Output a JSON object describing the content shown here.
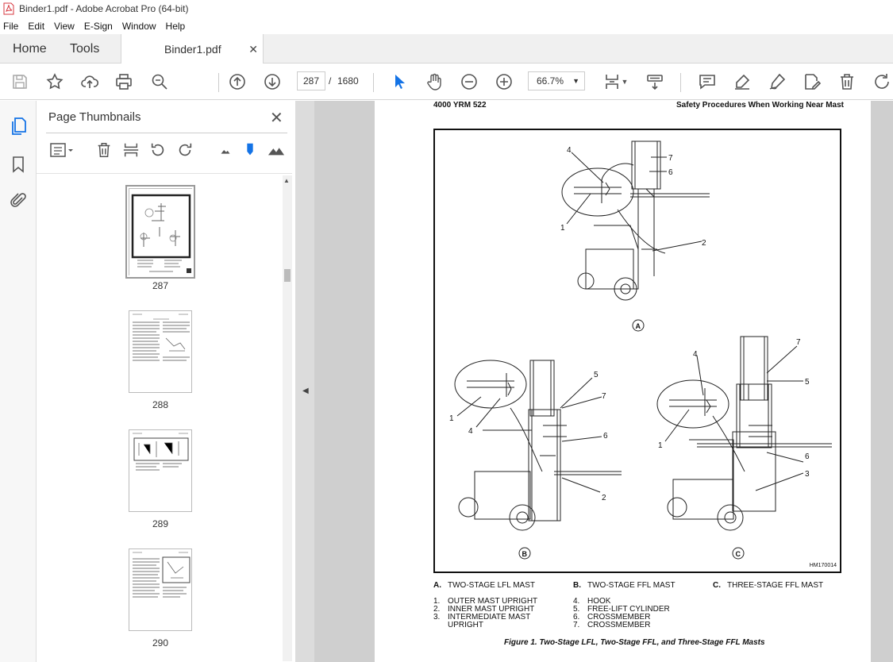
{
  "window": {
    "title": "Binder1.pdf - Adobe Acrobat Pro (64-bit)"
  },
  "menu": [
    "File",
    "Edit",
    "View",
    "E-Sign",
    "Window",
    "Help"
  ],
  "tabs": {
    "home": "Home",
    "tools": "Tools",
    "document": "Binder1.pdf"
  },
  "toolbar": {
    "page_current": "287",
    "page_separator": "/",
    "page_total": "1680",
    "zoom": "66.7%"
  },
  "panel": {
    "title": "Page Thumbnails"
  },
  "thumbnails": [
    {
      "label": "287",
      "selected": true
    },
    {
      "label": "288",
      "selected": false
    },
    {
      "label": "289",
      "selected": false
    },
    {
      "label": "290",
      "selected": false
    }
  ],
  "page": {
    "header_left": "4000 YRM 522",
    "header_right": "Safety Procedures When Working Near Mast",
    "figure_id": "HM170014",
    "view_labels": [
      "A",
      "B",
      "C"
    ],
    "callouts": {
      "a": [
        "4",
        "7",
        "6",
        "1",
        "2"
      ],
      "b": [
        "5",
        "7",
        "1",
        "4",
        "6",
        "2"
      ],
      "c": [
        "4",
        "7",
        "5",
        "1",
        "6",
        "3"
      ]
    },
    "legend_views": [
      {
        "key": "A.",
        "text": "TWO-STAGE LFL MAST"
      },
      {
        "key": "B.",
        "text": "TWO-STAGE FFL MAST"
      },
      {
        "key": "C.",
        "text": "THREE-STAGE FFL MAST"
      }
    ],
    "legend_left": [
      {
        "key": "1.",
        "text": "OUTER MAST UPRIGHT"
      },
      {
        "key": "2.",
        "text": "INNER MAST UPRIGHT"
      },
      {
        "key": "3.",
        "text": "INTERMEDIATE MAST"
      },
      {
        "key": "",
        "text": "UPRIGHT"
      }
    ],
    "legend_right": [
      {
        "key": "4.",
        "text": "HOOK"
      },
      {
        "key": "5.",
        "text": "FREE-LIFT CYLINDER"
      },
      {
        "key": "6.",
        "text": "CROSSMEMBER"
      },
      {
        "key": "7.",
        "text": "CROSSMEMBER"
      }
    ],
    "caption": "Figure 1. Two-Stage LFL, Two-Stage FFL, and Three-Stage FFL Masts"
  },
  "colors": {
    "accent_blue": "#1473e6",
    "toolbar_icon": "#555555",
    "pdf_red": "#d7373f"
  }
}
